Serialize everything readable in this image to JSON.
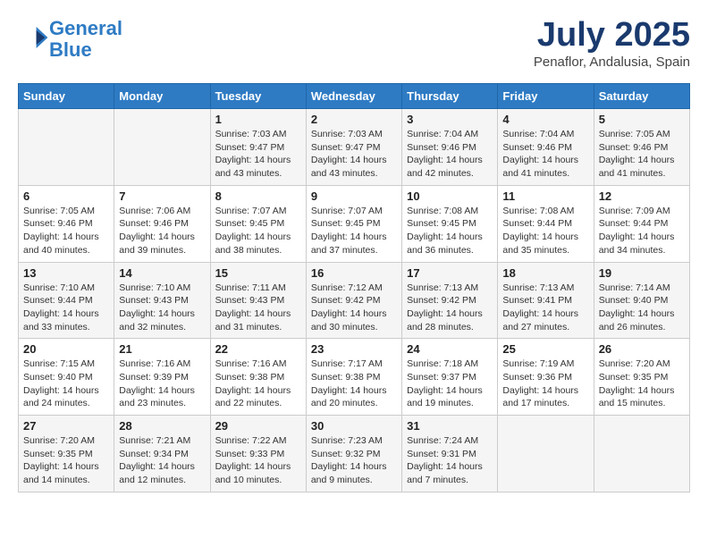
{
  "header": {
    "logo_line1": "General",
    "logo_line2": "Blue",
    "month": "July 2025",
    "location": "Penaflor, Andalusia, Spain"
  },
  "weekdays": [
    "Sunday",
    "Monday",
    "Tuesday",
    "Wednesday",
    "Thursday",
    "Friday",
    "Saturday"
  ],
  "weeks": [
    [
      {
        "day": "",
        "info": ""
      },
      {
        "day": "",
        "info": ""
      },
      {
        "day": "1",
        "info": "Sunrise: 7:03 AM\nSunset: 9:47 PM\nDaylight: 14 hours and 43 minutes."
      },
      {
        "day": "2",
        "info": "Sunrise: 7:03 AM\nSunset: 9:47 PM\nDaylight: 14 hours and 43 minutes."
      },
      {
        "day": "3",
        "info": "Sunrise: 7:04 AM\nSunset: 9:46 PM\nDaylight: 14 hours and 42 minutes."
      },
      {
        "day": "4",
        "info": "Sunrise: 7:04 AM\nSunset: 9:46 PM\nDaylight: 14 hours and 41 minutes."
      },
      {
        "day": "5",
        "info": "Sunrise: 7:05 AM\nSunset: 9:46 PM\nDaylight: 14 hours and 41 minutes."
      }
    ],
    [
      {
        "day": "6",
        "info": "Sunrise: 7:05 AM\nSunset: 9:46 PM\nDaylight: 14 hours and 40 minutes."
      },
      {
        "day": "7",
        "info": "Sunrise: 7:06 AM\nSunset: 9:46 PM\nDaylight: 14 hours and 39 minutes."
      },
      {
        "day": "8",
        "info": "Sunrise: 7:07 AM\nSunset: 9:45 PM\nDaylight: 14 hours and 38 minutes."
      },
      {
        "day": "9",
        "info": "Sunrise: 7:07 AM\nSunset: 9:45 PM\nDaylight: 14 hours and 37 minutes."
      },
      {
        "day": "10",
        "info": "Sunrise: 7:08 AM\nSunset: 9:45 PM\nDaylight: 14 hours and 36 minutes."
      },
      {
        "day": "11",
        "info": "Sunrise: 7:08 AM\nSunset: 9:44 PM\nDaylight: 14 hours and 35 minutes."
      },
      {
        "day": "12",
        "info": "Sunrise: 7:09 AM\nSunset: 9:44 PM\nDaylight: 14 hours and 34 minutes."
      }
    ],
    [
      {
        "day": "13",
        "info": "Sunrise: 7:10 AM\nSunset: 9:44 PM\nDaylight: 14 hours and 33 minutes."
      },
      {
        "day": "14",
        "info": "Sunrise: 7:10 AM\nSunset: 9:43 PM\nDaylight: 14 hours and 32 minutes."
      },
      {
        "day": "15",
        "info": "Sunrise: 7:11 AM\nSunset: 9:43 PM\nDaylight: 14 hours and 31 minutes."
      },
      {
        "day": "16",
        "info": "Sunrise: 7:12 AM\nSunset: 9:42 PM\nDaylight: 14 hours and 30 minutes."
      },
      {
        "day": "17",
        "info": "Sunrise: 7:13 AM\nSunset: 9:42 PM\nDaylight: 14 hours and 28 minutes."
      },
      {
        "day": "18",
        "info": "Sunrise: 7:13 AM\nSunset: 9:41 PM\nDaylight: 14 hours and 27 minutes."
      },
      {
        "day": "19",
        "info": "Sunrise: 7:14 AM\nSunset: 9:40 PM\nDaylight: 14 hours and 26 minutes."
      }
    ],
    [
      {
        "day": "20",
        "info": "Sunrise: 7:15 AM\nSunset: 9:40 PM\nDaylight: 14 hours and 24 minutes."
      },
      {
        "day": "21",
        "info": "Sunrise: 7:16 AM\nSunset: 9:39 PM\nDaylight: 14 hours and 23 minutes."
      },
      {
        "day": "22",
        "info": "Sunrise: 7:16 AM\nSunset: 9:38 PM\nDaylight: 14 hours and 22 minutes."
      },
      {
        "day": "23",
        "info": "Sunrise: 7:17 AM\nSunset: 9:38 PM\nDaylight: 14 hours and 20 minutes."
      },
      {
        "day": "24",
        "info": "Sunrise: 7:18 AM\nSunset: 9:37 PM\nDaylight: 14 hours and 19 minutes."
      },
      {
        "day": "25",
        "info": "Sunrise: 7:19 AM\nSunset: 9:36 PM\nDaylight: 14 hours and 17 minutes."
      },
      {
        "day": "26",
        "info": "Sunrise: 7:20 AM\nSunset: 9:35 PM\nDaylight: 14 hours and 15 minutes."
      }
    ],
    [
      {
        "day": "27",
        "info": "Sunrise: 7:20 AM\nSunset: 9:35 PM\nDaylight: 14 hours and 14 minutes."
      },
      {
        "day": "28",
        "info": "Sunrise: 7:21 AM\nSunset: 9:34 PM\nDaylight: 14 hours and 12 minutes."
      },
      {
        "day": "29",
        "info": "Sunrise: 7:22 AM\nSunset: 9:33 PM\nDaylight: 14 hours and 10 minutes."
      },
      {
        "day": "30",
        "info": "Sunrise: 7:23 AM\nSunset: 9:32 PM\nDaylight: 14 hours and 9 minutes."
      },
      {
        "day": "31",
        "info": "Sunrise: 7:24 AM\nSunset: 9:31 PM\nDaylight: 14 hours and 7 minutes."
      },
      {
        "day": "",
        "info": ""
      },
      {
        "day": "",
        "info": ""
      }
    ]
  ]
}
